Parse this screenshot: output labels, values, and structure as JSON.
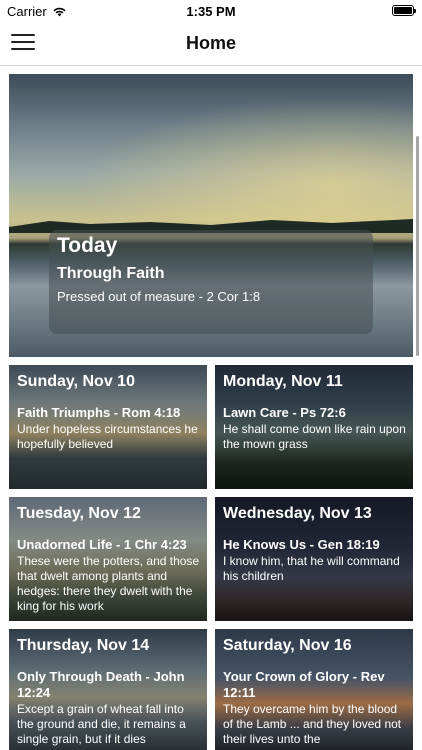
{
  "status_bar": {
    "carrier": "Carrier",
    "time": "1:35 PM"
  },
  "nav": {
    "title": "Home"
  },
  "hero": {
    "label": "Today",
    "title": "Through Faith",
    "subtitle": "Pressed out of measure - 2 Cor 1:8"
  },
  "cards": [
    {
      "date": "Sunday, Nov 10",
      "title": "Faith Triumphs - Rom 4:18",
      "text": "Under hopeless circumstances he hopefully believed"
    },
    {
      "date": "Monday, Nov 11",
      "title": "Lawn Care - Ps 72:6",
      "text": "He shall come down like rain upon the mown grass"
    },
    {
      "date": "Tuesday, Nov 12",
      "title": "Unadorned Life - 1 Chr 4:23",
      "text": "These were the potters, and those that dwelt among plants and hedges: there they dwelt with the king for his work"
    },
    {
      "date": "Wednesday, Nov 13",
      "title": "He Knows Us - Gen 18:19",
      "text": "I know him, that he will command his children"
    },
    {
      "date": "Thursday, Nov 14",
      "title": "Only Through Death - John 12:24",
      "text": "Except a grain of wheat fall into the ground and die, it remains a single grain, but if it dies"
    },
    {
      "date": "Saturday, Nov 16",
      "title": "Your Crown of Glory - Rev 12:11",
      "text": "They overcame him by the blood of the Lamb ... and they loved not their lives unto the"
    }
  ]
}
